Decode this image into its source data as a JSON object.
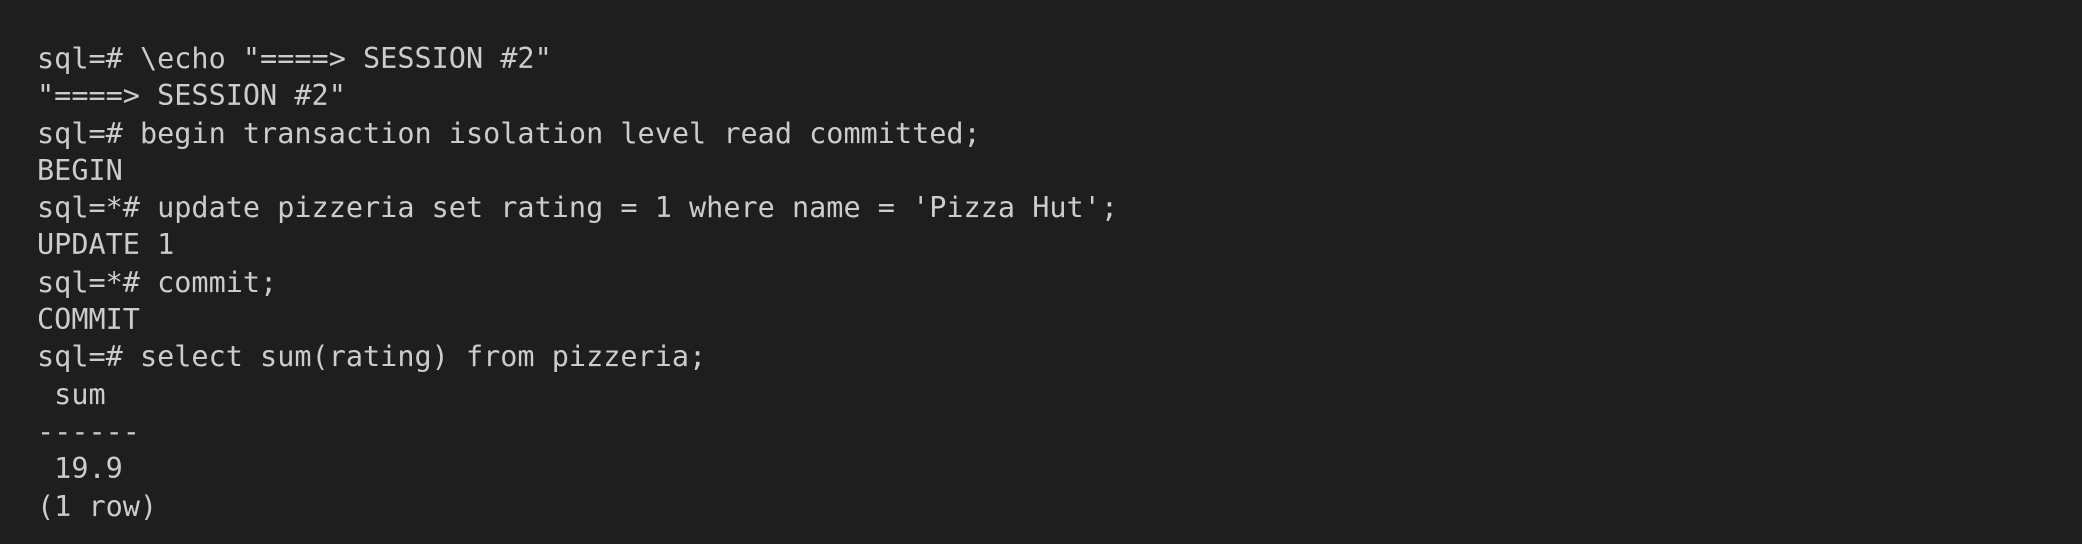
{
  "terminal": {
    "lines": [
      "sql=# \\echo \"====> SESSION #2\"",
      "\"====> SESSION #2\"",
      "sql=# begin transaction isolation level read committed;",
      "BEGIN",
      "sql=*# update pizzeria set rating = 1 where name = 'Pizza Hut';",
      "UPDATE 1",
      "sql=*# commit;",
      "COMMIT",
      "sql=# select sum(rating) from pizzeria;",
      " sum",
      "------",
      " 19.9",
      "(1 row)"
    ]
  }
}
